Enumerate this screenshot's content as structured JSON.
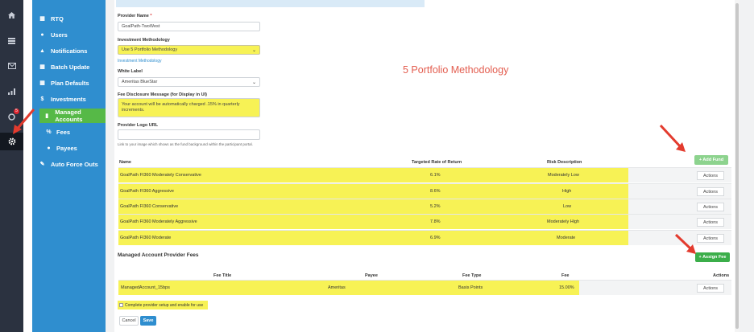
{
  "rail": {
    "icons": [
      "home-icon",
      "list-icon",
      "inbox-icon",
      "chart-icon",
      "alerts-icon",
      "gear-icon"
    ],
    "badge": "5"
  },
  "sidebar": {
    "items": [
      {
        "label": "RTQ",
        "icon": "table-icon"
      },
      {
        "label": "Users",
        "icon": "users-icon"
      },
      {
        "label": "Notifications",
        "icon": "bell-icon"
      },
      {
        "label": "Batch Update",
        "icon": "table-icon"
      },
      {
        "label": "Plan Defaults",
        "icon": "table-icon"
      },
      {
        "label": "Investments",
        "icon": "dollar-icon"
      },
      {
        "label": "Managed Accounts",
        "icon": "chart-icon",
        "active": true
      },
      {
        "label": "Fees",
        "icon": "percent-icon"
      },
      {
        "label": "Payees",
        "icon": "users-icon"
      },
      {
        "label": "Auto Force Outs",
        "icon": "edit-icon"
      }
    ]
  },
  "form": {
    "provider_name_label": "Provider Name",
    "required_mark": "*",
    "provider_name_value": "GoalPath-TwoWest",
    "investment_methodology_label": "Investment Methodology",
    "investment_methodology_value": "Use 5 Portfolio Methodology",
    "investment_methodology_link": "Investment Methodology",
    "white_label_label": "White Label",
    "white_label_value": "Ameritas BlueStar",
    "fee_disclosure_label": "Fee Disclosure Message (for Display in UI)",
    "fee_disclosure_value": "Your account will be automatically charged .15% in quarterly increments.",
    "logo_url_label": "Provider Logo URL",
    "logo_url_value": "",
    "logo_url_help": "Link to your image which shows as the fund background within the participant portal."
  },
  "annotation": "5 Portfolio Methodology",
  "portfolio_table": {
    "add_button": "+ Add Fund",
    "headers": [
      "Name",
      "Targeted Rate of Return",
      "Risk Description"
    ],
    "rows": [
      {
        "name": "GoalPath FI360 Moderately Conservative",
        "rate": "6.1%",
        "risk": "Moderately Low",
        "action": "Actions"
      },
      {
        "name": "GoalPath FI360 Aggressive",
        "rate": "8.6%",
        "risk": "High",
        "action": "Actions"
      },
      {
        "name": "GoalPath FI360 Conservative",
        "rate": "5.2%",
        "risk": "Low",
        "action": "Actions"
      },
      {
        "name": "GoalPath FI360 Moderately Aggressive",
        "rate": "7.8%",
        "risk": "Moderately High",
        "action": "Actions"
      },
      {
        "name": "GoalPath FI360 Moderate",
        "rate": "6.9%",
        "risk": "Moderate",
        "action": "Actions"
      }
    ]
  },
  "fees": {
    "section_title": "Managed Account Provider Fees",
    "assign_button": "+ Assign Fee",
    "headers": [
      "Fee Title",
      "Payee",
      "Fee Type",
      "Fee",
      "Actions"
    ],
    "rows": [
      {
        "title": "ManagedAccount_15bps",
        "payee": "Ameritas",
        "type": "Basis Points",
        "fee": "15.00%",
        "action": "Actions"
      }
    ]
  },
  "footer": {
    "complete_label": "Complete provider setup and enable for use",
    "cancel": "Cancel",
    "save": "Save"
  },
  "colors": {
    "sidebar_blue": "#2f8ecf",
    "active_green": "#56b947",
    "highlight_yellow": "#f7f255",
    "annotation_red": "#e35d4f"
  }
}
